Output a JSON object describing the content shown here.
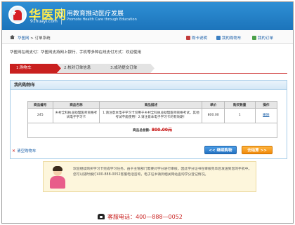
{
  "header": {
    "logo_name": "华医网",
    "logo_domain": "91huayi.com",
    "slogan_cn": "用教育推动医疗发展",
    "slogan_en": "Promote Health Care through Education"
  },
  "nav": {
    "breadcrumb_home": "华医网",
    "breadcrumb_sep": " > ",
    "breadcrumb_current": "订单系统",
    "links": [
      {
        "label": "购卡说明",
        "icon": "card-icon"
      },
      {
        "label": "我的购物车",
        "icon": "cart-icon"
      },
      {
        "label": "我的订单",
        "icon": "order-icon"
      }
    ]
  },
  "notice": "华医网在线支付：华医网支持网上银行、手机等多种在线支付方式：欢迎使用",
  "steps": [
    {
      "label": "1.购物车"
    },
    {
      "label": "2.核对订单信息"
    },
    {
      "label": "3.成功提交订单"
    }
  ],
  "cart": {
    "title": "我的购物车",
    "columns": [
      "商品编号",
      "商品名称",
      "商品描述",
      "单价",
      "购买数量",
      "操作"
    ],
    "rows": [
      {
        "id": "245",
        "name": "乡村全科执业助理医师资格考试电子学习卡",
        "description": "1.请注意本电子学习卡仅用于乡村全科执业助理医师资格考试，其他考试不能使用！2.请注意本电子学习卡的有效期！",
        "price": "800.00",
        "quantity": "1",
        "action": "删除"
      }
    ],
    "total_label": "商品总金额:",
    "total_value": "800.00元"
  },
  "buttons": {
    "continue": "<< 继续购物",
    "checkout": "去结算 >>"
  },
  "clear_cart": "清空购物车",
  "tip": "欢迎继续购买学习卡完成学习任务。由于主管部门需要对学分进行审核，因此学分证书在审核完毕后发送到您的手机中。您可以随时拨打400-888-0052客服电话咨询，电子证书请到相关网站查询学分登记情况。",
  "hotline": {
    "label": "客服电话：",
    "number": "400—888—0052"
  }
}
